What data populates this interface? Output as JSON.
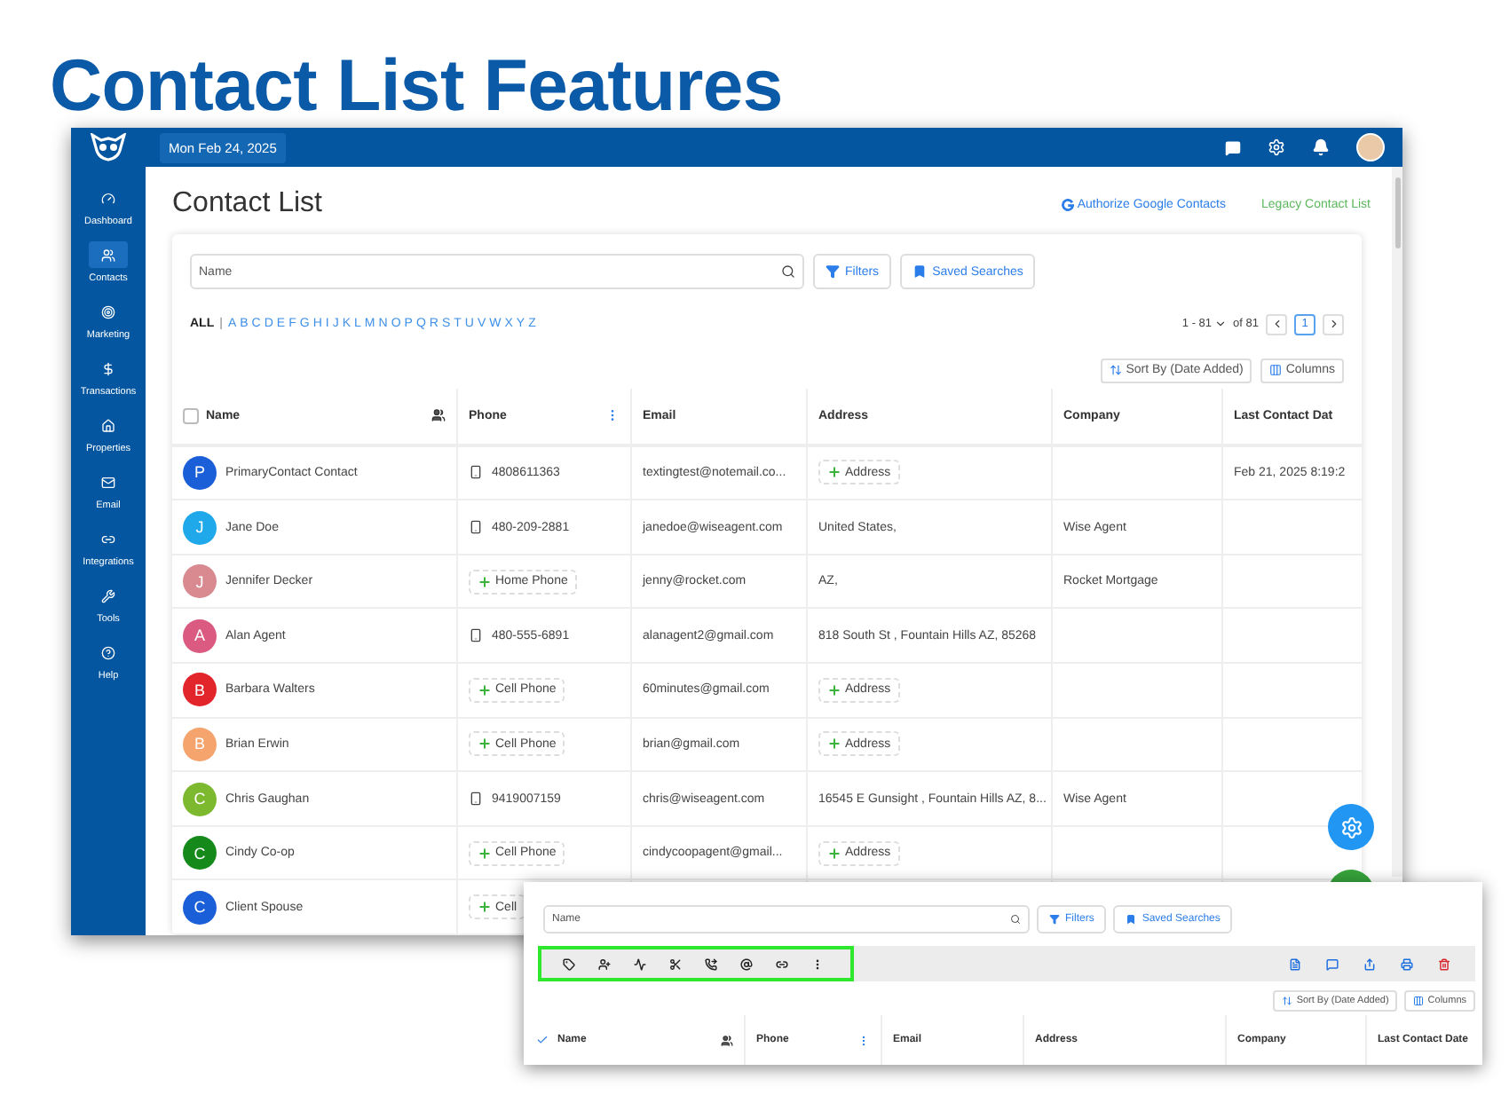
{
  "heading": "Contact List Features",
  "app": {
    "date": "Mon Feb 24, 2025",
    "sidebar": [
      {
        "label": "Dashboard",
        "selected": false
      },
      {
        "label": "Contacts",
        "selected": true
      },
      {
        "label": "Marketing",
        "selected": false
      },
      {
        "label": "Transactions",
        "selected": false
      },
      {
        "label": "Properties",
        "selected": false
      },
      {
        "label": "Email",
        "selected": false
      },
      {
        "label": "Integrations",
        "selected": false
      },
      {
        "label": "Tools",
        "selected": false
      },
      {
        "label": "Help",
        "selected": false
      }
    ],
    "page_title": "Contact List",
    "links": [
      {
        "label": "Authorize Google Contacts",
        "kind": "google"
      },
      {
        "label": "Legacy Contact List",
        "kind": "legacy"
      }
    ],
    "search": {
      "placeholder": "Name"
    },
    "filters": "Filters",
    "saved_searches": "Saved Searches",
    "alphabet": {
      "separator": "|",
      "letters": [
        {
          "label": "ALL",
          "selected": true
        },
        {
          "label": "A",
          "selected": false
        },
        {
          "label": "B",
          "selected": false
        },
        {
          "label": "C",
          "selected": false
        },
        {
          "label": "D",
          "selected": false
        },
        {
          "label": "E",
          "selected": false
        },
        {
          "label": "F",
          "selected": false
        },
        {
          "label": "G",
          "selected": false
        },
        {
          "label": "H",
          "selected": false
        },
        {
          "label": "I",
          "selected": false
        },
        {
          "label": "J",
          "selected": false
        },
        {
          "label": "K",
          "selected": false
        },
        {
          "label": "L",
          "selected": false
        },
        {
          "label": "M",
          "selected": false
        },
        {
          "label": "N",
          "selected": false
        },
        {
          "label": "O",
          "selected": false
        },
        {
          "label": "P",
          "selected": false
        },
        {
          "label": "Q",
          "selected": false
        },
        {
          "label": "R",
          "selected": false
        },
        {
          "label": "S",
          "selected": false
        },
        {
          "label": "T",
          "selected": false
        },
        {
          "label": "U",
          "selected": false
        },
        {
          "label": "V",
          "selected": false
        },
        {
          "label": "W",
          "selected": false
        },
        {
          "label": "X",
          "selected": false
        },
        {
          "label": "Y",
          "selected": false
        },
        {
          "label": "Z",
          "selected": false
        }
      ]
    },
    "pagination": {
      "range": "1 - 81",
      "total": "of 81",
      "page": "1"
    },
    "sort": "Sort By (Date Added)",
    "columns_button": "Columns",
    "table": {
      "select_all": false,
      "columns": [
        "Name",
        "Phone",
        "Email",
        "Address",
        "Company",
        "Last Contact Dat"
      ],
      "rows": [
        {
          "initial": "P",
          "color": "#1b5fd8",
          "name": "PrimaryContact Contact",
          "phone": {
            "kind": "number",
            "text": "4808611363"
          },
          "email": "textingtest@notemail.co...",
          "address": {
            "kind": "add",
            "text": "Address"
          },
          "company": "",
          "last_contact": "Feb 21, 2025 8:19:2"
        },
        {
          "initial": "J",
          "color": "#1fa8ea",
          "name": "Jane Doe",
          "phone": {
            "kind": "number",
            "text": "480-209-2881"
          },
          "email": "janedoe@wiseagent.com",
          "address": {
            "kind": "text",
            "text": "United States,"
          },
          "company": "Wise Agent",
          "last_contact": ""
        },
        {
          "initial": "J",
          "color": "#d98a90",
          "name": "Jennifer Decker",
          "phone": {
            "kind": "add",
            "text": "Home Phone"
          },
          "email": "jenny@rocket.com",
          "address": {
            "kind": "text",
            "text": "AZ,"
          },
          "company": "Rocket Mortgage",
          "last_contact": ""
        },
        {
          "initial": "A",
          "color": "#db5a82",
          "name": "Alan Agent",
          "phone": {
            "kind": "number",
            "text": "480-555-6891"
          },
          "email": "alanagent2@gmail.com",
          "address": {
            "kind": "text",
            "text": "818 South St , Fountain Hills AZ, 85268"
          },
          "company": "",
          "last_contact": ""
        },
        {
          "initial": "B",
          "color": "#e2252b",
          "name": "Barbara Walters",
          "phone": {
            "kind": "add",
            "text": "Cell Phone"
          },
          "email": "60minutes@gmail.com",
          "address": {
            "kind": "add",
            "text": "Address"
          },
          "company": "",
          "last_contact": ""
        },
        {
          "initial": "B",
          "color": "#f4a46c",
          "name": "Brian Erwin",
          "phone": {
            "kind": "add",
            "text": "Cell Phone"
          },
          "email": "brian@gmail.com",
          "address": {
            "kind": "add",
            "text": "Address"
          },
          "company": "",
          "last_contact": ""
        },
        {
          "initial": "C",
          "color": "#7cb92f",
          "name": "Chris Gaughan",
          "phone": {
            "kind": "number",
            "text": "9419007159"
          },
          "email": "chris@wiseagent.com",
          "address": {
            "kind": "text",
            "text": "16545 E Gunsight , Fountain Hills AZ, 8..."
          },
          "company": "Wise Agent",
          "last_contact": ""
        },
        {
          "initial": "C",
          "color": "#158a1b",
          "name": "Cindy Co-op",
          "phone": {
            "kind": "add",
            "text": "Cell Phone"
          },
          "email": "cindycoopagent@gmail...",
          "address": {
            "kind": "add",
            "text": "Address"
          },
          "company": "",
          "last_contact": ""
        },
        {
          "initial": "C",
          "color": "#1b5fd8",
          "name": "Client Spouse",
          "phone": {
            "kind": "add",
            "text": "Cell"
          },
          "email": "",
          "address": {
            "kind": "none"
          },
          "company": "",
          "last_contact": ""
        }
      ]
    }
  },
  "inset": {
    "search": {
      "placeholder": "Name"
    },
    "filters": "Filters",
    "saved_searches": "Saved Searches",
    "toolbar": {
      "highlighted": true
    },
    "sort": "Sort By (Date Added)",
    "columns_button": "Columns",
    "select_all": true,
    "columns": [
      "Name",
      "Phone",
      "Email",
      "Address",
      "Company",
      "Last Contact Date"
    ]
  }
}
